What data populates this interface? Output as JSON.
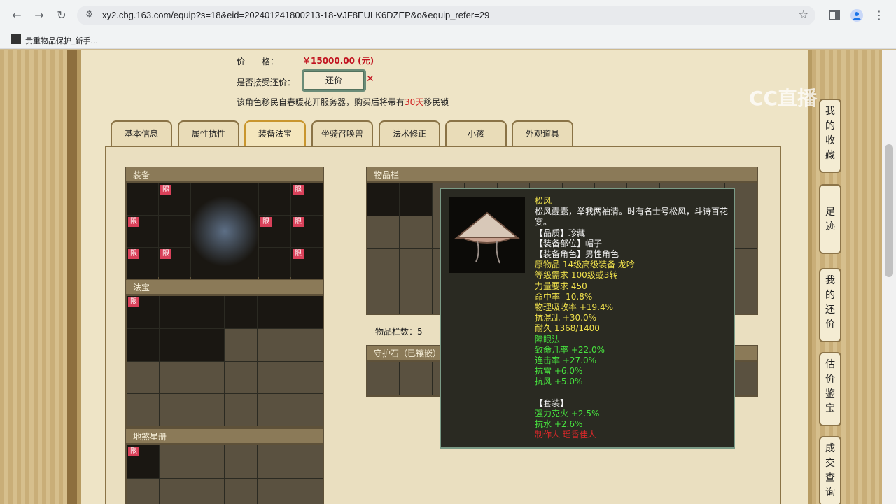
{
  "browser": {
    "url": "xy2.cbg.163.com/equip?s=18&eid=202401241800213-18-VJF8EULK6DZEP&o&equip_refer=29",
    "bookmark": "贵重物品保护_新手..."
  },
  "watermark": "CC直播",
  "header": {
    "price_label": "价　　格：",
    "price_value": "￥15000.00 (元)",
    "bargain_label": "是否接受还价：",
    "bargain_button": "还价",
    "bargain_mark": "✕",
    "migrate_prefix": "该角色移民自春暖花开服务器，购买后将带有",
    "migrate_days": "30天",
    "migrate_suffix": "移民锁"
  },
  "tabs": [
    "基本信息",
    "属性抗性",
    "装备法宝",
    "坐骑召唤兽",
    "法术修正",
    "小孩",
    "外观道具"
  ],
  "active_tab": "装备法宝",
  "panels": {
    "equipment": "装备",
    "fabao": "法宝",
    "disha": "地煞星册",
    "inventory": "物品栏",
    "inventory_count": "物品栏数：5",
    "guardstone": "守护石（已镶嵌）"
  },
  "limit_badge": "限",
  "tooltip": {
    "name": "松风",
    "desc": "松风蠹蠹，举我两袖清。时有名士号松风，斗诗百花宴。",
    "quality": "【品质】珍藏",
    "slot": "【装备部位】帽子",
    "role": "【装备角色】男性角色",
    "origin": "原物品 14级高级装备 龙吟",
    "level_req": "等级需求 100级或3转",
    "str_req": "力量要求 450",
    "hit": "命中率 -10.8%",
    "phys_abs": "物理吸收率 +19.4%",
    "anti_chaos": "抗混乱 +30.0%",
    "durability": "耐久 1368/1400",
    "blind": "障眼法",
    "crit": "致命几率 +22.0%",
    "combo": "连击率 +27.0%",
    "anti_thunder": "抗雷 +6.0%",
    "anti_wind": "抗风 +5.0%",
    "set_title": "【套装】",
    "set_fire": "强力克火 +2.5%",
    "set_water": "抗水 +2.6%",
    "maker": "制作人 瑶香佳人"
  },
  "sidebar": [
    "我的收藏",
    "足迹",
    "我的还价",
    "估价鉴宝",
    "成交查询"
  ],
  "colors": {
    "price": "#c1121f",
    "green": "#47e23f",
    "yellow": "#f0e14c",
    "maker": "#d8282a"
  }
}
